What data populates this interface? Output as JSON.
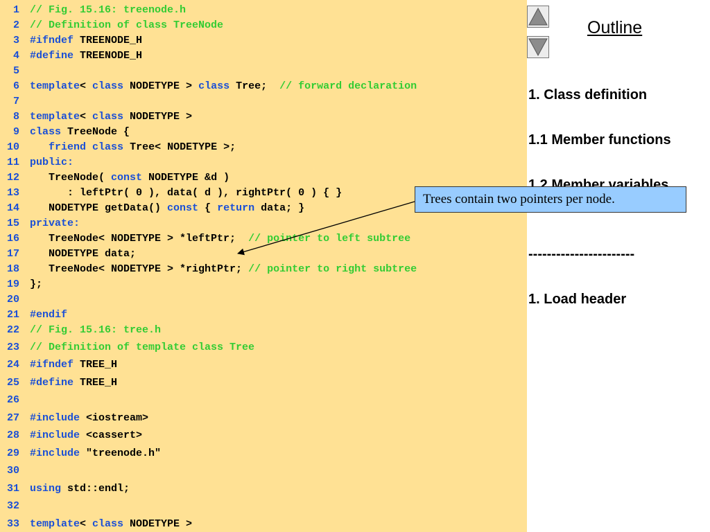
{
  "code_lines": [
    {
      "num": "1",
      "segments": [
        {
          "t": "// Fig. 15.16: treenode.h",
          "c": "cm"
        }
      ]
    },
    {
      "num": "2",
      "segments": [
        {
          "t": "// Definition of class TreeNode",
          "c": "cm"
        }
      ]
    },
    {
      "num": "3",
      "segments": [
        {
          "t": "#ifndef",
          "c": "kw"
        },
        {
          "t": " TREENODE_H",
          "c": "tx"
        }
      ]
    },
    {
      "num": "4",
      "segments": [
        {
          "t": "#define",
          "c": "kw"
        },
        {
          "t": " TREENODE_H",
          "c": "tx"
        }
      ]
    },
    {
      "num": "5",
      "segments": []
    },
    {
      "num": "6",
      "segments": [
        {
          "t": "template",
          "c": "kw"
        },
        {
          "t": "< ",
          "c": "tx"
        },
        {
          "t": "class",
          "c": "kw"
        },
        {
          "t": " NODETYPE > ",
          "c": "tx"
        },
        {
          "t": "class",
          "c": "kw"
        },
        {
          "t": " Tree;  ",
          "c": "tx"
        },
        {
          "t": "// forward declaration",
          "c": "cm"
        }
      ]
    },
    {
      "num": "7",
      "segments": []
    },
    {
      "num": "8",
      "segments": [
        {
          "t": "template",
          "c": "kw"
        },
        {
          "t": "< ",
          "c": "tx"
        },
        {
          "t": "class",
          "c": "kw"
        },
        {
          "t": " NODETYPE >",
          "c": "tx"
        }
      ]
    },
    {
      "num": "9",
      "segments": [
        {
          "t": "class",
          "c": "kw"
        },
        {
          "t": " TreeNode {",
          "c": "tx"
        }
      ]
    },
    {
      "num": "10",
      "segments": [
        {
          "t": "   ",
          "c": "tx"
        },
        {
          "t": "friend",
          "c": "kw"
        },
        {
          "t": " ",
          "c": "tx"
        },
        {
          "t": "class",
          "c": "kw"
        },
        {
          "t": " Tree< NODETYPE >;",
          "c": "tx"
        }
      ]
    },
    {
      "num": "11",
      "segments": [
        {
          "t": "public:",
          "c": "kw"
        }
      ]
    },
    {
      "num": "12",
      "segments": [
        {
          "t": "   TreeNode( ",
          "c": "tx"
        },
        {
          "t": "const",
          "c": "kw"
        },
        {
          "t": " NODETYPE &d )",
          "c": "tx"
        }
      ]
    },
    {
      "num": "13",
      "segments": [
        {
          "t": "      : leftPtr( 0 ), data( d ), rightPtr( 0 ) { }",
          "c": "tx"
        }
      ]
    },
    {
      "num": "14",
      "segments": [
        {
          "t": "   NODETYPE getData() ",
          "c": "tx"
        },
        {
          "t": "const",
          "c": "kw"
        },
        {
          "t": " { ",
          "c": "tx"
        },
        {
          "t": "return",
          "c": "kw"
        },
        {
          "t": " data; }",
          "c": "tx"
        }
      ]
    },
    {
      "num": "15",
      "segments": [
        {
          "t": "private:",
          "c": "kw"
        }
      ]
    },
    {
      "num": "16",
      "segments": [
        {
          "t": "   TreeNode< NODETYPE > *leftPtr;  ",
          "c": "tx"
        },
        {
          "t": "// pointer to left subtree",
          "c": "cm"
        }
      ]
    },
    {
      "num": "17",
      "segments": [
        {
          "t": "   NODETYPE data;",
          "c": "tx"
        }
      ]
    },
    {
      "num": "18",
      "segments": [
        {
          "t": "   TreeNode< NODETYPE > *rightPtr; ",
          "c": "tx"
        },
        {
          "t": "// pointer to right subtree",
          "c": "cm"
        }
      ]
    },
    {
      "num": "19",
      "segments": [
        {
          "t": "};",
          "c": "tx"
        }
      ]
    },
    {
      "num": "20",
      "segments": []
    },
    {
      "num": "21",
      "segments": [
        {
          "t": "#endif",
          "c": "kw"
        }
      ]
    },
    {
      "num": "22",
      "segments": [
        {
          "t": "// Fig. 15.16: tree.h",
          "c": "cm"
        }
      ]
    },
    {
      "num": "23",
      "segments": [
        {
          "t": "// Definition of template class Tree",
          "c": "cm"
        }
      ]
    },
    {
      "num": "24",
      "segments": [
        {
          "t": "#ifndef",
          "c": "kw"
        },
        {
          "t": " TREE_H",
          "c": "tx"
        }
      ]
    },
    {
      "num": "25",
      "segments": [
        {
          "t": "#define",
          "c": "kw"
        },
        {
          "t": " TREE_H",
          "c": "tx"
        }
      ]
    },
    {
      "num": "26",
      "segments": []
    },
    {
      "num": "27",
      "segments": [
        {
          "t": "#include",
          "c": "kw"
        },
        {
          "t": " <iostream>",
          "c": "tx"
        }
      ]
    },
    {
      "num": "28",
      "segments": [
        {
          "t": "#include",
          "c": "kw"
        },
        {
          "t": " <cassert>",
          "c": "tx"
        }
      ]
    },
    {
      "num": "29",
      "segments": [
        {
          "t": "#include",
          "c": "kw"
        },
        {
          "t": " \"treenode.h\"",
          "c": "tx"
        }
      ]
    },
    {
      "num": "30",
      "segments": []
    },
    {
      "num": "31",
      "segments": [
        {
          "t": "using",
          "c": "kw"
        },
        {
          "t": " std::endl;",
          "c": "tx"
        }
      ]
    },
    {
      "num": "32",
      "segments": []
    },
    {
      "num": "33",
      "segments": [
        {
          "t": "template",
          "c": "kw"
        },
        {
          "t": "< ",
          "c": "tx"
        },
        {
          "t": "class",
          "c": "kw"
        },
        {
          "t": " NODETYPE >",
          "c": "tx"
        }
      ]
    }
  ],
  "outline": {
    "title": "Outline",
    "items": [
      "1. Class definition",
      "1.1 Member functions",
      "1.2 Member variables",
      "-----------------------",
      "1. Load header"
    ]
  },
  "callout": {
    "text": "Trees contain two pointers per node."
  },
  "nav": {
    "up_icon": "triangle-up-icon",
    "down_icon": "triangle-down-icon"
  },
  "colors": {
    "code_background": "#ffe194",
    "keyword": "#1a4fd6",
    "comment": "#33cc33",
    "callout_background": "#98ccff"
  }
}
